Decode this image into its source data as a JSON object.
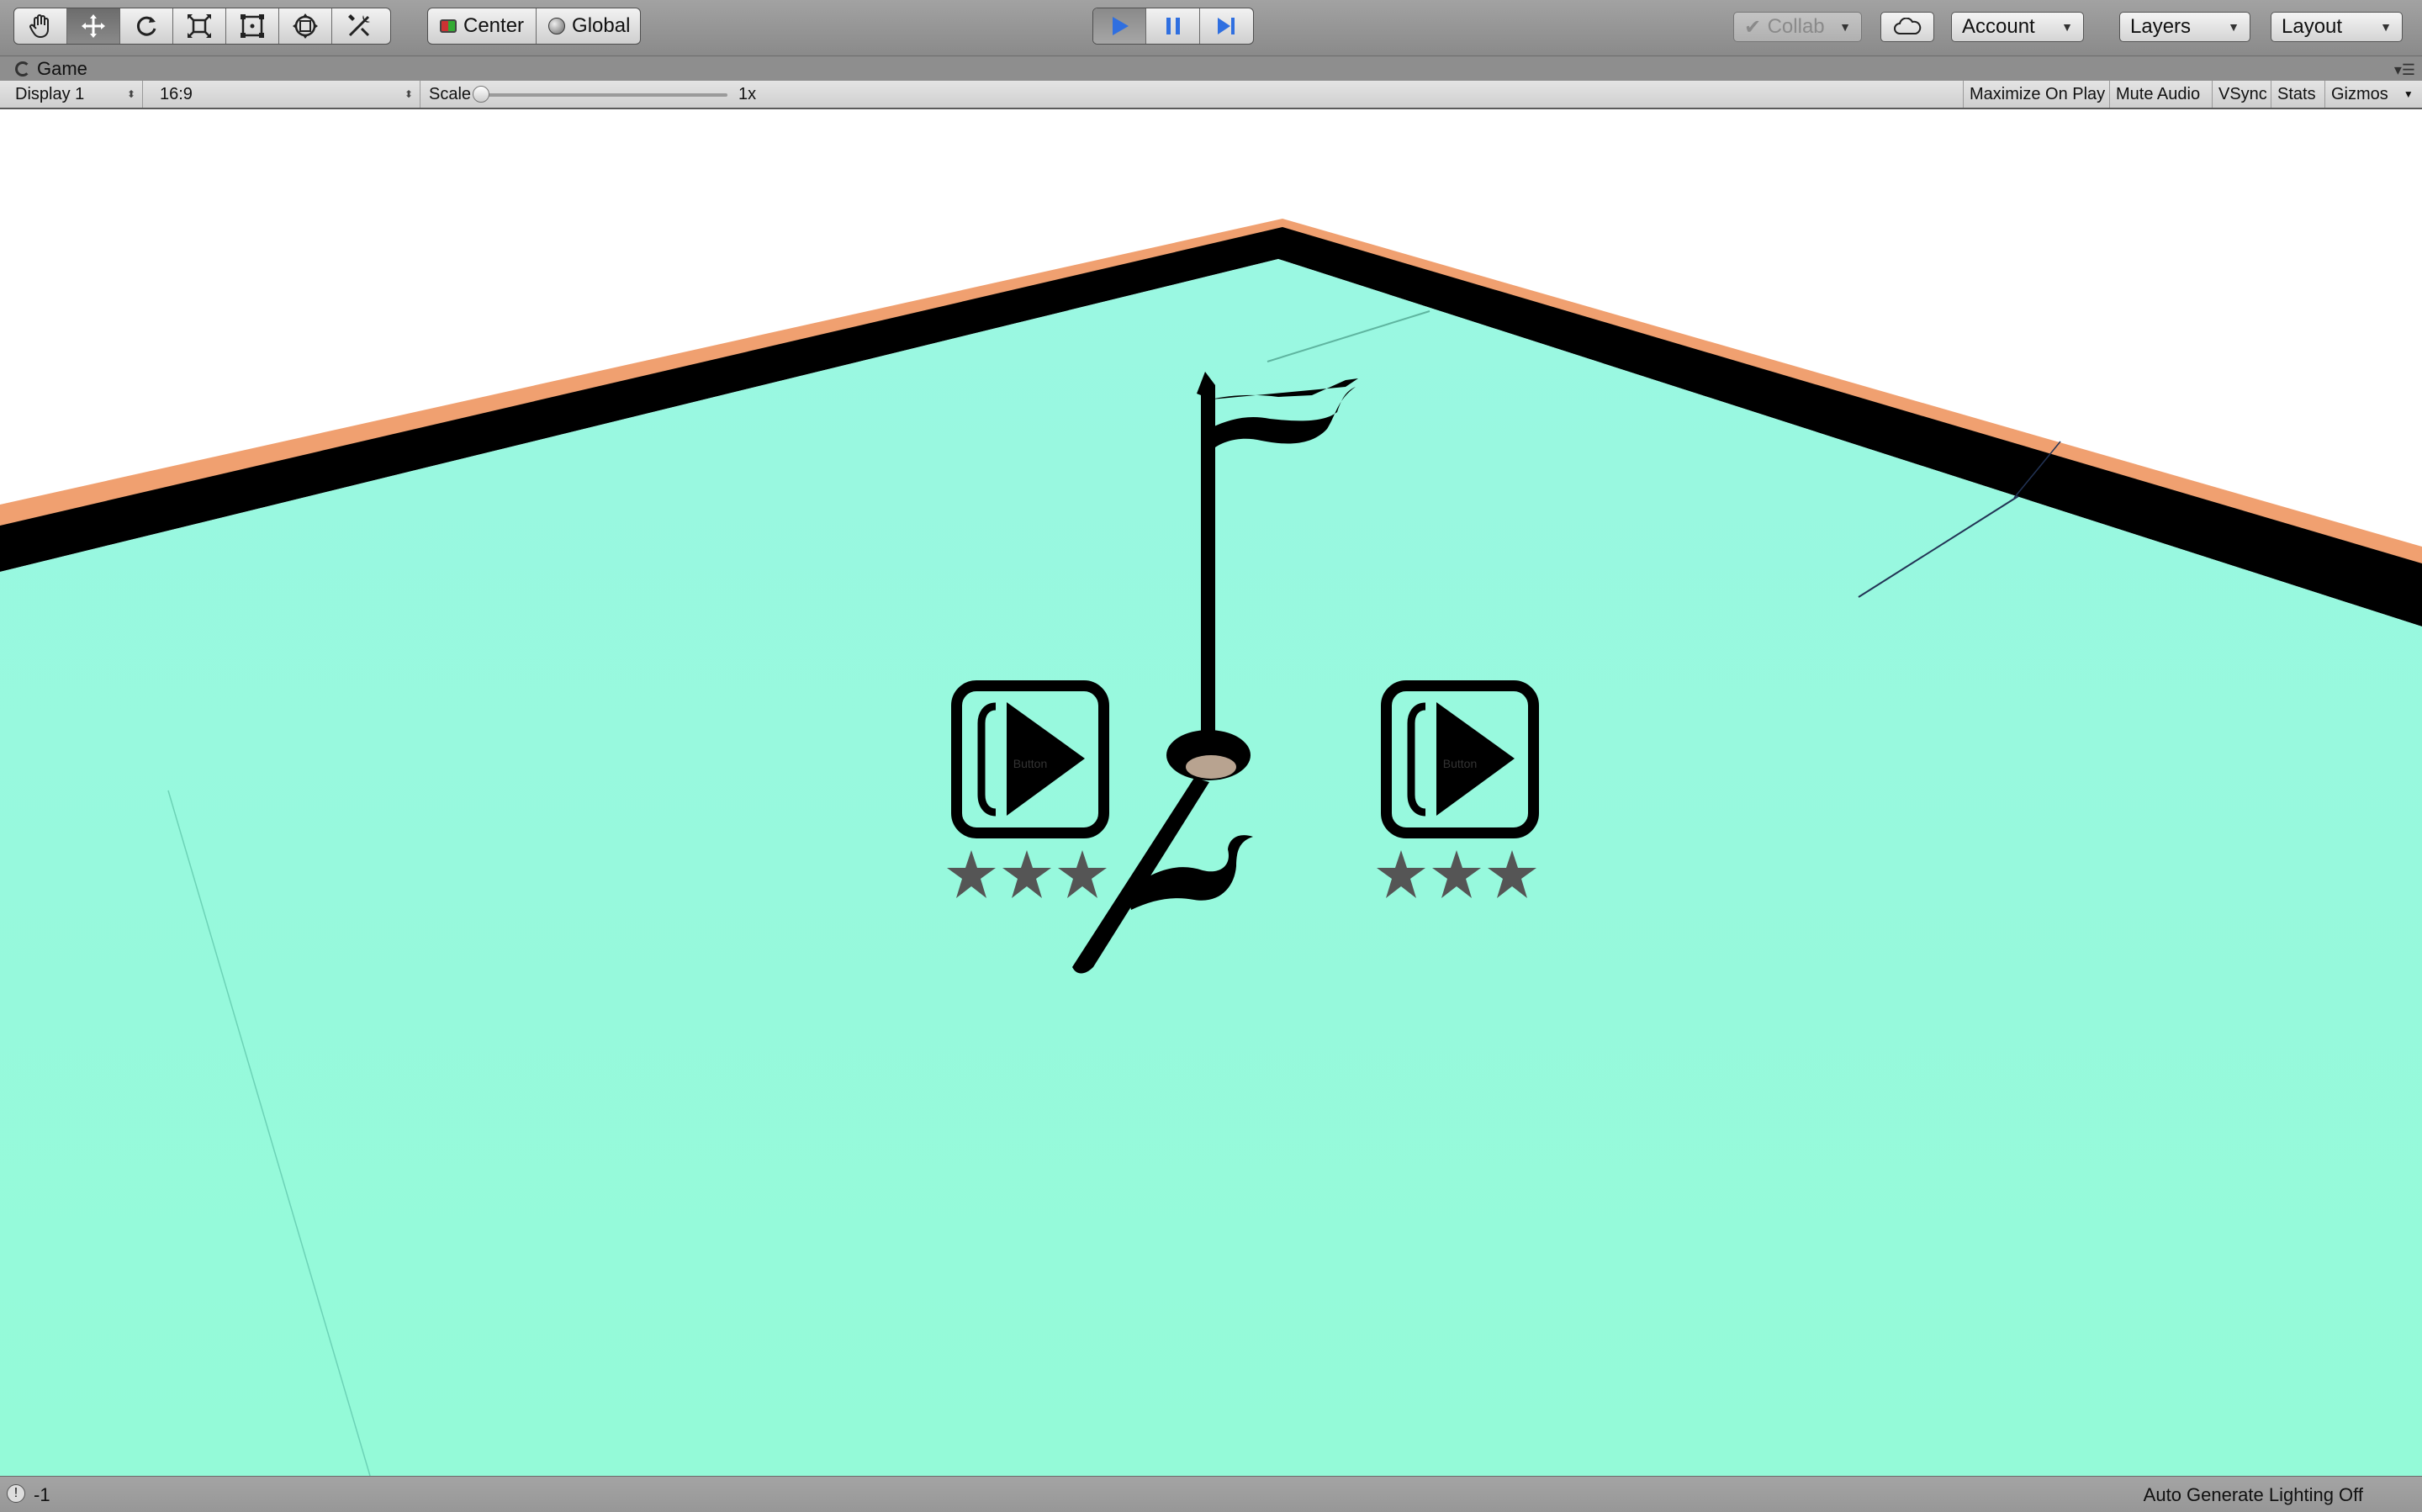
{
  "toolbar": {
    "tools": [
      {
        "name": "hand-tool",
        "icon": "hand-icon"
      },
      {
        "name": "move-tool",
        "icon": "move-arrows-icon",
        "active": true
      },
      {
        "name": "rotate-tool",
        "icon": "rotate-icon"
      },
      {
        "name": "scale-tool",
        "icon": "scale-icon"
      },
      {
        "name": "rect-tool",
        "icon": "rect-transform-icon"
      },
      {
        "name": "transform-tool",
        "icon": "transform-icon"
      },
      {
        "name": "custom-tool",
        "icon": "tools-icon"
      }
    ],
    "pivot_label": "Center",
    "space_label": "Global",
    "play_icon": "play-icon",
    "pause_icon": "pause-icon",
    "step_icon": "step-icon",
    "play_color": "#2f6fe0",
    "collab_label": "Collab",
    "cloud_icon": "cloud-icon",
    "account_label": "Account",
    "layers_label": "Layers",
    "layout_label": "Layout"
  },
  "tab": {
    "title": "Game",
    "menu_icon": "tab-menu-icon"
  },
  "gamebar": {
    "display": "Display 1",
    "aspect": "16:9",
    "scale_label": "Scale",
    "scale_value": "1x",
    "scale_fraction": 0.0,
    "toggles": [
      "Maximize On Play",
      "Mute Audio",
      "VSync",
      "Stats",
      "Gizmos"
    ]
  },
  "scene": {
    "floor_color": "#98f8dc",
    "rim_color": "#f0a070",
    "wall_color": "#000000",
    "sky_color": "#ffffff",
    "buttons": [
      {
        "label": "Button",
        "stars": 3
      },
      {
        "label": "Button",
        "stars": 3
      }
    ],
    "star_color": "#555555"
  },
  "status": {
    "message": "-1",
    "right": "Auto Generate Lighting Off"
  }
}
